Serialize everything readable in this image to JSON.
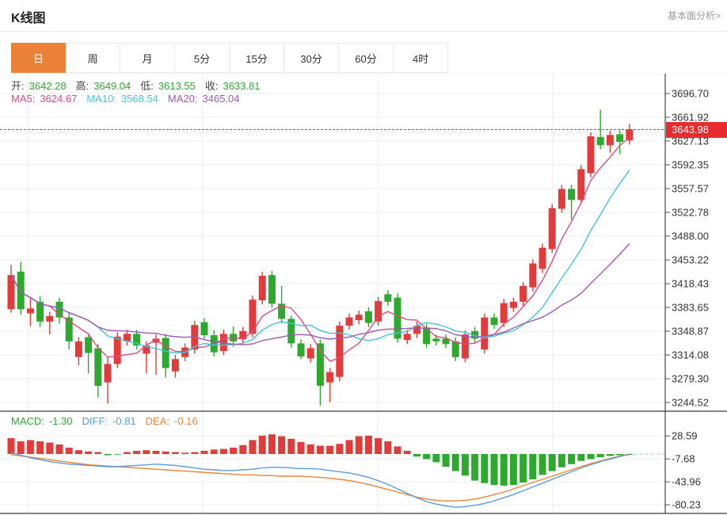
{
  "header": {
    "title": "K线图",
    "link": "基本面分析>"
  },
  "tabs": {
    "selected": 0,
    "items": [
      {
        "id": "day",
        "label": "日"
      },
      {
        "id": "week",
        "label": "周"
      },
      {
        "id": "month",
        "label": "月"
      },
      {
        "id": "5min",
        "label": "5分"
      },
      {
        "id": "15min",
        "label": "15分"
      },
      {
        "id": "30min",
        "label": "30分"
      },
      {
        "id": "60min",
        "label": "60分"
      },
      {
        "id": "4hour",
        "label": "4时"
      }
    ]
  },
  "legend_ohlc": [
    {
      "id": "open",
      "label": "开:",
      "value": "3642.28"
    },
    {
      "id": "high",
      "label": "高:",
      "value": "3649.04"
    },
    {
      "id": "low",
      "label": "低:",
      "value": "3613.55"
    },
    {
      "id": "close",
      "label": "收:",
      "value": "3633.81"
    }
  ],
  "legend_ma": [
    {
      "id": "ma5",
      "label": "MA5:",
      "value": "3624.67",
      "color": "#e5487d"
    },
    {
      "id": "ma10",
      "label": "MA10:",
      "value": "3568.54",
      "color": "#3ec6dc"
    },
    {
      "id": "ma20",
      "label": "MA20:",
      "value": "3465.04",
      "color": "#9d5ab5"
    }
  ],
  "legend_macd": [
    {
      "id": "macd",
      "label": "MACD:",
      "value": "-1.30",
      "color": "#2daa2d"
    },
    {
      "id": "diff",
      "label": "DIFF:",
      "value": "-0.81",
      "color": "#5a9ce0"
    },
    {
      "id": "dea",
      "label": "DEA:",
      "value": "-0.16",
      "color": "#f08130"
    }
  ],
  "price_badge": "3643.98",
  "colors": {
    "up": "#e23b3b",
    "down": "#2daa2d",
    "ma5": "#e5487d",
    "ma10": "#3ec6dc",
    "ma20": "#9d5ab5",
    "diff": "#5a9ce0",
    "dea": "#f08130",
    "price_line": "#f03030",
    "grid": "#ececec",
    "axis": "#444",
    "tick_text": "#333",
    "badge": "#e62c2c",
    "accent_tab": "#ec8138"
  },
  "chart_data": {
    "type": "candlestick",
    "title": "K线图 日K",
    "price_line": 3643.98,
    "panels": [
      {
        "name": "price",
        "y_ticks": [
          "3696.70",
          "3661.92",
          "3627.13",
          "3592.35",
          "3557.57",
          "3522.78",
          "3488.00",
          "3453.22",
          "3418.43",
          "3383.65",
          "3348.87",
          "3314.08",
          "3279.30",
          "3244.52"
        ],
        "tick_step": 34.78,
        "ma_periods": [
          5,
          10,
          20
        ],
        "candles_ohlc": [
          [
            3381,
            3446,
            3376,
            3431
          ],
          [
            3436,
            3450,
            3373,
            3381
          ],
          [
            3375,
            3397,
            3356,
            3382
          ],
          [
            3392,
            3400,
            3355,
            3363
          ],
          [
            3363,
            3377,
            3344,
            3371
          ],
          [
            3392,
            3398,
            3360,
            3369
          ],
          [
            3369,
            3375,
            3322,
            3334
          ],
          [
            3311,
            3340,
            3299,
            3334
          ],
          [
            3340,
            3346,
            3287,
            3317
          ],
          [
            3324,
            3330,
            3252,
            3269
          ],
          [
            3274,
            3311,
            3243,
            3301
          ],
          [
            3301,
            3347,
            3295,
            3341
          ],
          [
            3334,
            3351,
            3328,
            3345
          ],
          [
            3345,
            3351,
            3322,
            3328
          ],
          [
            3316,
            3334,
            3287,
            3328
          ],
          [
            3332,
            3344,
            3285,
            3338
          ],
          [
            3339,
            3345,
            3281,
            3295
          ],
          [
            3290,
            3314,
            3281,
            3308
          ],
          [
            3311,
            3331,
            3305,
            3325
          ],
          [
            3322,
            3364,
            3316,
            3358
          ],
          [
            3362,
            3368,
            3338,
            3343
          ],
          [
            3343,
            3350,
            3312,
            3318
          ],
          [
            3320,
            3351,
            3314,
            3345
          ],
          [
            3345,
            3356,
            3326,
            3334
          ],
          [
            3337,
            3355,
            3330,
            3349
          ],
          [
            3345,
            3401,
            3340,
            3395
          ],
          [
            3394,
            3436,
            3388,
            3430
          ],
          [
            3431,
            3437,
            3383,
            3389
          ],
          [
            3389,
            3415,
            3361,
            3367
          ],
          [
            3367,
            3372,
            3325,
            3331
          ],
          [
            3331,
            3337,
            3308,
            3312
          ],
          [
            3309,
            3330,
            3303,
            3324
          ],
          [
            3331,
            3337,
            3240,
            3269
          ],
          [
            3274,
            3295,
            3245,
            3289
          ],
          [
            3282,
            3363,
            3276,
            3357
          ],
          [
            3357,
            3375,
            3351,
            3369
          ],
          [
            3365,
            3379,
            3359,
            3373
          ],
          [
            3378,
            3384,
            3355,
            3361
          ],
          [
            3363,
            3399,
            3357,
            3393
          ],
          [
            3403,
            3409,
            3386,
            3392
          ],
          [
            3398,
            3404,
            3332,
            3338
          ],
          [
            3336,
            3351,
            3330,
            3345
          ],
          [
            3345,
            3363,
            3339,
            3357
          ],
          [
            3354,
            3360,
            3324,
            3330
          ],
          [
            3338,
            3344,
            3328,
            3334
          ],
          [
            3338,
            3344,
            3324,
            3330
          ],
          [
            3334,
            3340,
            3305,
            3311
          ],
          [
            3309,
            3350,
            3303,
            3344
          ],
          [
            3349,
            3355,
            3332,
            3338
          ],
          [
            3322,
            3375,
            3316,
            3369
          ],
          [
            3369,
            3375,
            3352,
            3358
          ],
          [
            3361,
            3396,
            3355,
            3390
          ],
          [
            3383,
            3398,
            3377,
            3392
          ],
          [
            3392,
            3421,
            3386,
            3415
          ],
          [
            3413,
            3454,
            3407,
            3448
          ],
          [
            3440,
            3477,
            3434,
            3471
          ],
          [
            3469,
            3535,
            3463,
            3529
          ],
          [
            3528,
            3563,
            3522,
            3557
          ],
          [
            3557,
            3563,
            3512,
            3541
          ],
          [
            3541,
            3592,
            3535,
            3586
          ],
          [
            3580,
            3640,
            3574,
            3634
          ],
          [
            3633,
            3673,
            3615,
            3621
          ],
          [
            3621,
            3642,
            3610,
            3636
          ],
          [
            3637,
            3643,
            3608,
            3626
          ],
          [
            3628,
            3652,
            3622,
            3643.98
          ]
        ]
      },
      {
        "name": "macd",
        "y_ticks": [
          "28.59",
          "-7.68",
          "-43.96",
          "-80.23"
        ],
        "macd": [
          25,
          20,
          22,
          20,
          18,
          15,
          10,
          6,
          4,
          3,
          -2,
          -1,
          3,
          5,
          6,
          5,
          4,
          3,
          2,
          3,
          5,
          7,
          8,
          10,
          14,
          22,
          29,
          31,
          28,
          24,
          19,
          15,
          13,
          13,
          16,
          22,
          28,
          29,
          25,
          20,
          12,
          5,
          -4,
          -8,
          -13,
          -20,
          -27,
          -34,
          -42,
          -46,
          -49,
          -50,
          -49,
          -45,
          -40,
          -33,
          -27,
          -21,
          -16,
          -11,
          -8,
          -5,
          -3,
          -2,
          -1.3
        ],
        "diff": [
          2,
          -2,
          -6,
          -9,
          -12,
          -14,
          -16,
          -17,
          -18,
          -19,
          -20,
          -20,
          -19,
          -18,
          -17,
          -16,
          -17,
          -18,
          -20,
          -22,
          -24,
          -25,
          -26,
          -26,
          -25,
          -24,
          -22,
          -21,
          -21,
          -22,
          -23,
          -23,
          -24,
          -26,
          -28,
          -30,
          -33,
          -37,
          -42,
          -48,
          -55,
          -62,
          -69,
          -75,
          -79,
          -82,
          -84,
          -83,
          -81,
          -78,
          -74,
          -69,
          -64,
          -58,
          -52,
          -46,
          -40,
          -34,
          -28,
          -22,
          -17,
          -12,
          -8,
          -4,
          -0.81
        ],
        "dea": [
          -1,
          -3,
          -5,
          -7,
          -9,
          -11,
          -13,
          -15,
          -17,
          -18,
          -19,
          -20,
          -21,
          -22,
          -23,
          -24,
          -25,
          -26,
          -27,
          -28,
          -29,
          -30,
          -31,
          -32,
          -33,
          -33,
          -34,
          -34,
          -35,
          -35,
          -35,
          -36,
          -37,
          -38,
          -40,
          -42,
          -45,
          -48,
          -52,
          -56,
          -60,
          -64,
          -68,
          -71,
          -73,
          -74,
          -74,
          -73,
          -71,
          -68,
          -64,
          -60,
          -55,
          -50,
          -45,
          -40,
          -35,
          -30,
          -25,
          -20,
          -15,
          -11,
          -7,
          -3.5,
          -0.16
        ]
      }
    ]
  }
}
